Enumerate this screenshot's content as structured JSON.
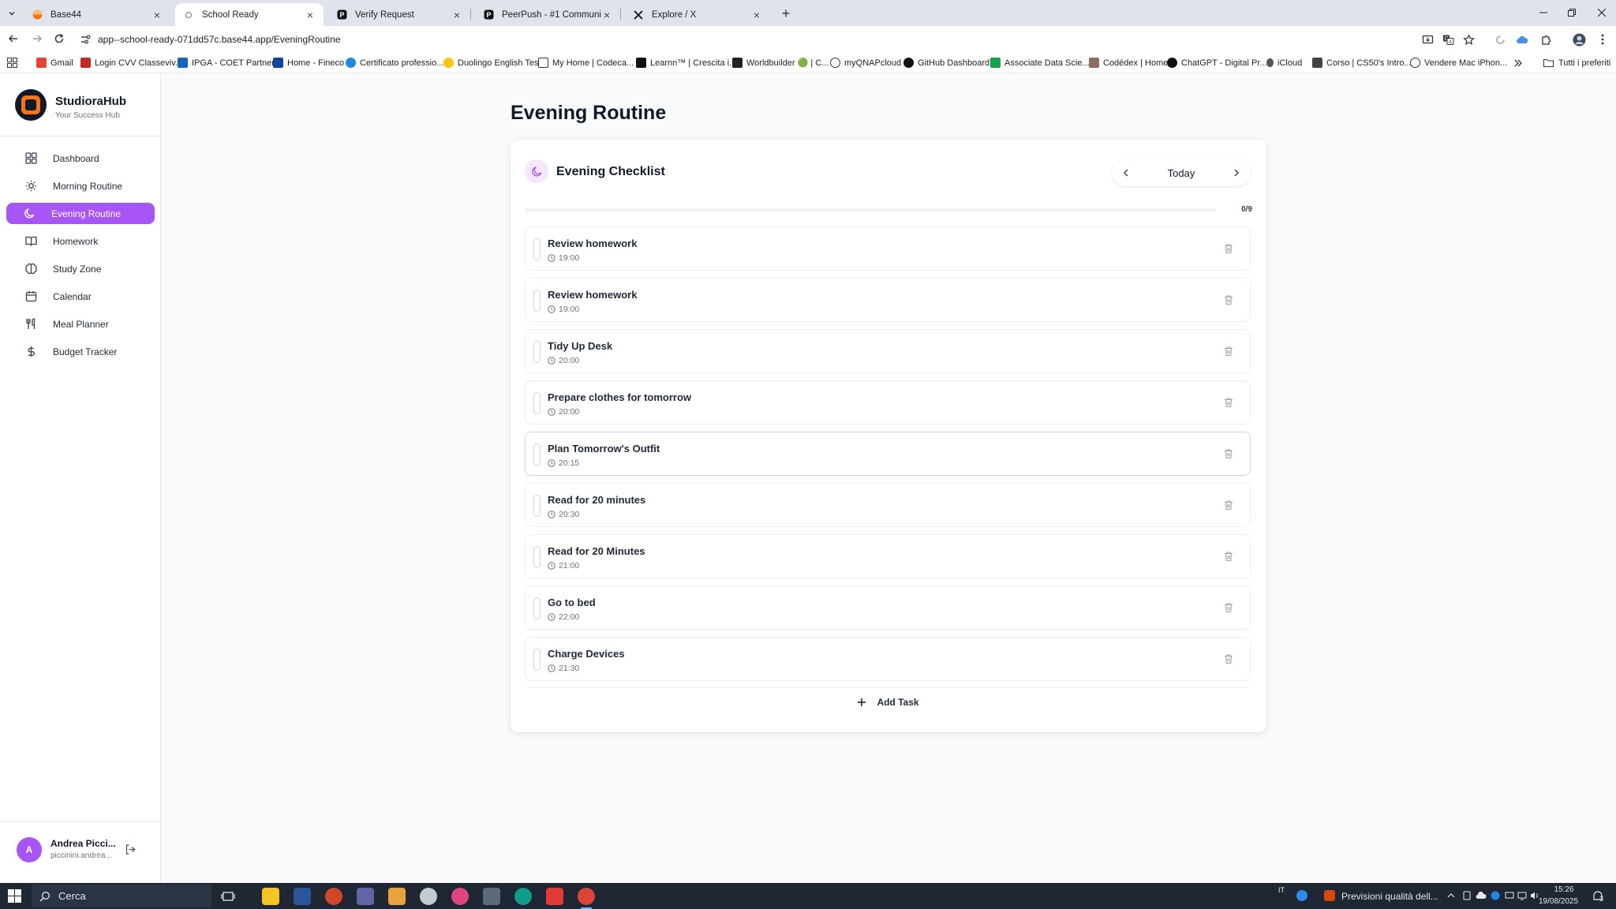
{
  "browser": {
    "tabs": [
      {
        "label": "Base44",
        "active": false
      },
      {
        "label": "School Ready",
        "active": true
      },
      {
        "label": "Verify Request",
        "active": false
      },
      {
        "label": "PeerPush - #1 Community for I",
        "active": false
      },
      {
        "label": "Explore / X",
        "active": false
      }
    ],
    "url": "app--school-ready-071dd57c.base44.app/EveningRoutine",
    "bookmarks": [
      "Gmail",
      "Login CVV Classeviv...",
      "IPGA - COET Partners",
      "Home - Fineco",
      "Certificato professio...",
      "Duolingo English Test",
      "My Home | Codeca...",
      "Learnn™ | Crescita i...",
      "Worldbuilder 🟢 | C...",
      "myQNAPcloud",
      "GitHub Dashboard",
      "Associate Data Scie...",
      "Codédex | Home",
      "ChatGPT - Digital Pr...",
      "iCloud",
      "Corso | CS50's Intro...",
      "Vendere Mac iPhon..."
    ],
    "all_bookmarks": "Tutti i preferiti"
  },
  "sidebar": {
    "brand": {
      "name": "StudioraHub",
      "tagline": "Your Success Hub"
    },
    "items": [
      {
        "label": "Dashboard",
        "icon": "grid-icon"
      },
      {
        "label": "Morning Routine",
        "icon": "sun-icon"
      },
      {
        "label": "Evening Routine",
        "icon": "moon-icon",
        "active": true
      },
      {
        "label": "Homework",
        "icon": "book-icon"
      },
      {
        "label": "Study Zone",
        "icon": "brain-icon"
      },
      {
        "label": "Calendar",
        "icon": "calendar-icon"
      },
      {
        "label": "Meal Planner",
        "icon": "utensils-icon"
      },
      {
        "label": "Budget Tracker",
        "icon": "dollar-icon"
      }
    ],
    "user": {
      "initial": "A",
      "name": "Andrea Picci...",
      "email": "piccinini.andrea..."
    }
  },
  "main": {
    "title": "Evening Routine",
    "card": {
      "title": "Evening Checklist",
      "date_label": "Today",
      "progress": {
        "done": 0,
        "total": 9,
        "label": "0/9"
      },
      "tasks": [
        {
          "name": "Review homework",
          "time": "19:00"
        },
        {
          "name": "Review homework",
          "time": "19:00"
        },
        {
          "name": "Tidy Up Desk",
          "time": "20:00"
        },
        {
          "name": "Prepare clothes for tomorrow",
          "time": "20:00"
        },
        {
          "name": "Plan Tomorrow's Outfit",
          "time": "20:15"
        },
        {
          "name": "Read for 20 minutes",
          "time": "20:30"
        },
        {
          "name": "Read for 20 Minutes",
          "time": "21:00"
        },
        {
          "name": "Go to bed",
          "time": "22:00"
        },
        {
          "name": "Charge Devices",
          "time": "21:30"
        }
      ],
      "add_label": "Add Task"
    }
  },
  "colors": {
    "accent": "#a855f7",
    "accent_light": "#f3e8ff",
    "brand_orange": "#f97316"
  },
  "taskbar": {
    "search_placeholder": "Cerca",
    "lang": "IT",
    "weather_text": "Previsioni qualità dell...",
    "time": "15:26",
    "date": "19/08/2025",
    "notifications": "3"
  }
}
